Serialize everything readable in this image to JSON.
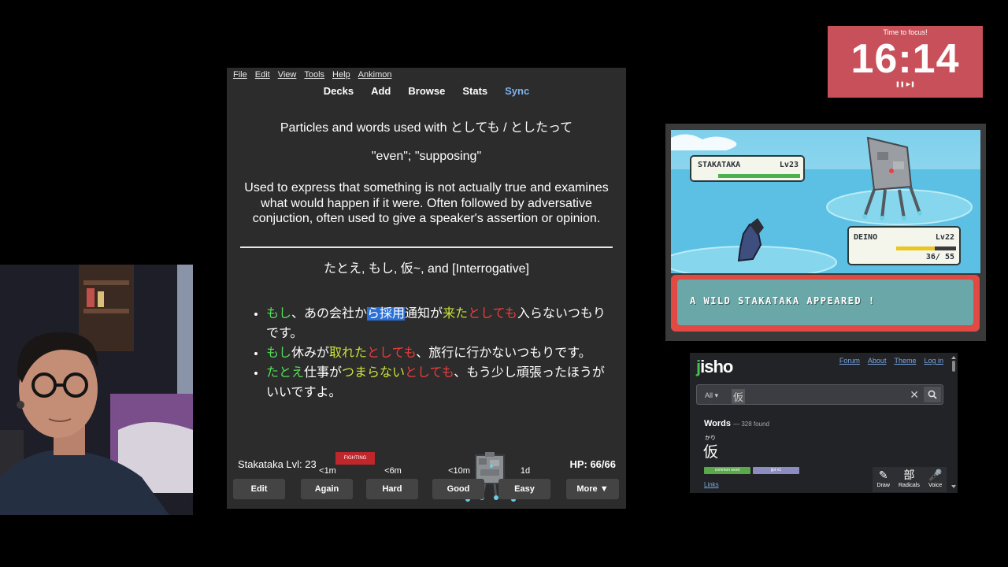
{
  "anki": {
    "menu": [
      "File",
      "Edit",
      "View",
      "Tools",
      "Help",
      "Ankimon"
    ],
    "toolbar": {
      "decks": "Decks",
      "add": "Add",
      "browse": "Browse",
      "stats": "Stats",
      "sync": "Sync"
    },
    "card": {
      "title": "Particles and words used with としても / としたって",
      "meaning": "\"even\"; \"supposing\"",
      "description": "Used to express that something is not actually true and examines what would happen if it were. Often followed by adversative conjuction, often used to give a speaker's assertion or opinion.",
      "subtitle": "たとえ, もし, 仮~, and [Interrogative]",
      "examples": [
        {
          "a": "もし",
          "b": "、あの会社か",
          "c": "ら採用",
          "d": "通知が",
          "e": "来た",
          "f": "としても",
          "g": "入らないつもりです。"
        },
        {
          "a": "もし",
          "b": "休みが",
          "e": "取れた",
          "f": "としても",
          "g": "、旅行に行かないつもりです。"
        },
        {
          "a": "たとえ",
          "b": "仕事が",
          "e": "つまらない",
          "f": "としても",
          "g": "、もう少し頑張ったほうがいいですよ。"
        }
      ]
    },
    "battle": {
      "name": "Stakataka Lvl: 23",
      "type": "FIGHTING",
      "hp": "HP: 66/66"
    },
    "buttons": [
      {
        "time": "",
        "label": "Edit"
      },
      {
        "time": "<1m",
        "label": "Again"
      },
      {
        "time": "<6m",
        "label": "Hard"
      },
      {
        "time": "<10m",
        "label": "Good"
      },
      {
        "time": "1d",
        "label": "Easy"
      },
      {
        "time": "",
        "label": "More ▼"
      }
    ]
  },
  "timer": {
    "label": "Time to focus!",
    "time": "16:14",
    "controls": "❚❚ ▶❚"
  },
  "game": {
    "enemy": {
      "name": "STAKATAKA",
      "level": "Lv23"
    },
    "player": {
      "name": "DEINO",
      "level": "Lv22",
      "hp": "36/ 55"
    },
    "message": "A WILD STAKATAKA APPEARED !"
  },
  "jisho": {
    "logo_j": "j",
    "logo_rest": "isho",
    "nav": [
      "Forum",
      "About",
      "Theme",
      "Log in"
    ],
    "filter": "All",
    "query": "仮",
    "words_label": "Words",
    "words_count": "— 328 found",
    "furigana": "かり",
    "kanji": "仮",
    "tags": [
      "common word",
      "jlpt n1"
    ],
    "links": "Links",
    "tools": [
      {
        "icon": "✎",
        "label": "Draw"
      },
      {
        "icon": "部",
        "label": "Radicals"
      },
      {
        "icon": "🎤",
        "label": "Voice"
      }
    ]
  },
  "colors": {
    "accent_sync": "#7fb2f0",
    "green": "#54e05a",
    "red": "#f03c3c",
    "highlight": "#2a6fd6",
    "timer_bg": "#c8505a"
  }
}
